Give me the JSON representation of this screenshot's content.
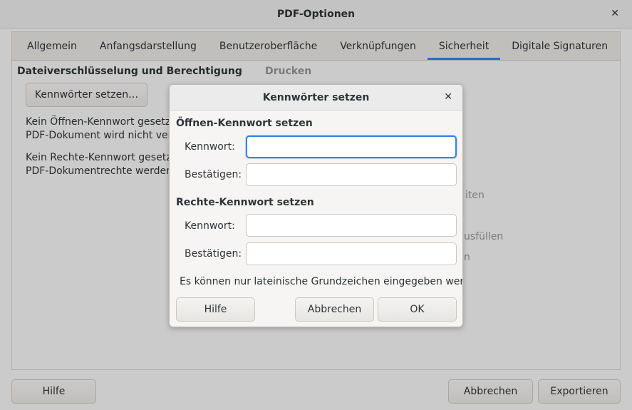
{
  "window": {
    "title": "PDF-Optionen"
  },
  "tabs": [
    {
      "label": "Allgemein"
    },
    {
      "label": "Anfangsdarstellung"
    },
    {
      "label": "Benutzeroberfläche"
    },
    {
      "label": "Verknüpfungen"
    },
    {
      "label": "Sicherheit"
    },
    {
      "label": "Digitale Signaturen"
    }
  ],
  "active_tab": "Sicherheit",
  "security": {
    "encryption_heading": "Dateiverschlüsselung und Berechtigung",
    "print_heading": "Drucken",
    "set_passwords_button": "Kennwörter setzen…",
    "open_pw_status_line1": "Kein Öffnen-Kennwort gesetzt",
    "open_pw_status_line2": "PDF-Dokument wird nicht verso",
    "rights_pw_status_line1": "Kein Rechte-Kennwort gesetzt",
    "rights_pw_status_line2": "PDF-Dokumentrechte werden n",
    "bg_fragment_1": "iten",
    "bg_fragment_2": "usfüllen",
    "bg_fragment_3": "n"
  },
  "footer": {
    "help_label": "Hilfe",
    "cancel_label": "Abbrechen",
    "export_label": "Exportieren"
  },
  "dialog": {
    "title": "Kennwörter setzen",
    "open_section": "Öffnen-Kennwort setzen",
    "rights_section": "Rechte-Kennwort setzen",
    "password_label": "Kennwort:",
    "confirm_label": "Bestätigen:",
    "open_password_value": "",
    "open_confirm_value": "",
    "rights_password_value": "",
    "rights_confirm_value": "",
    "info": "Es können nur lateinische Grundzeichen eingegeben werden",
    "help_label": "Hilfe",
    "cancel_label": "Abbrechen",
    "ok_label": "OK"
  },
  "colors": {
    "accent": "#3584e4",
    "background": "#f6f5f4"
  }
}
